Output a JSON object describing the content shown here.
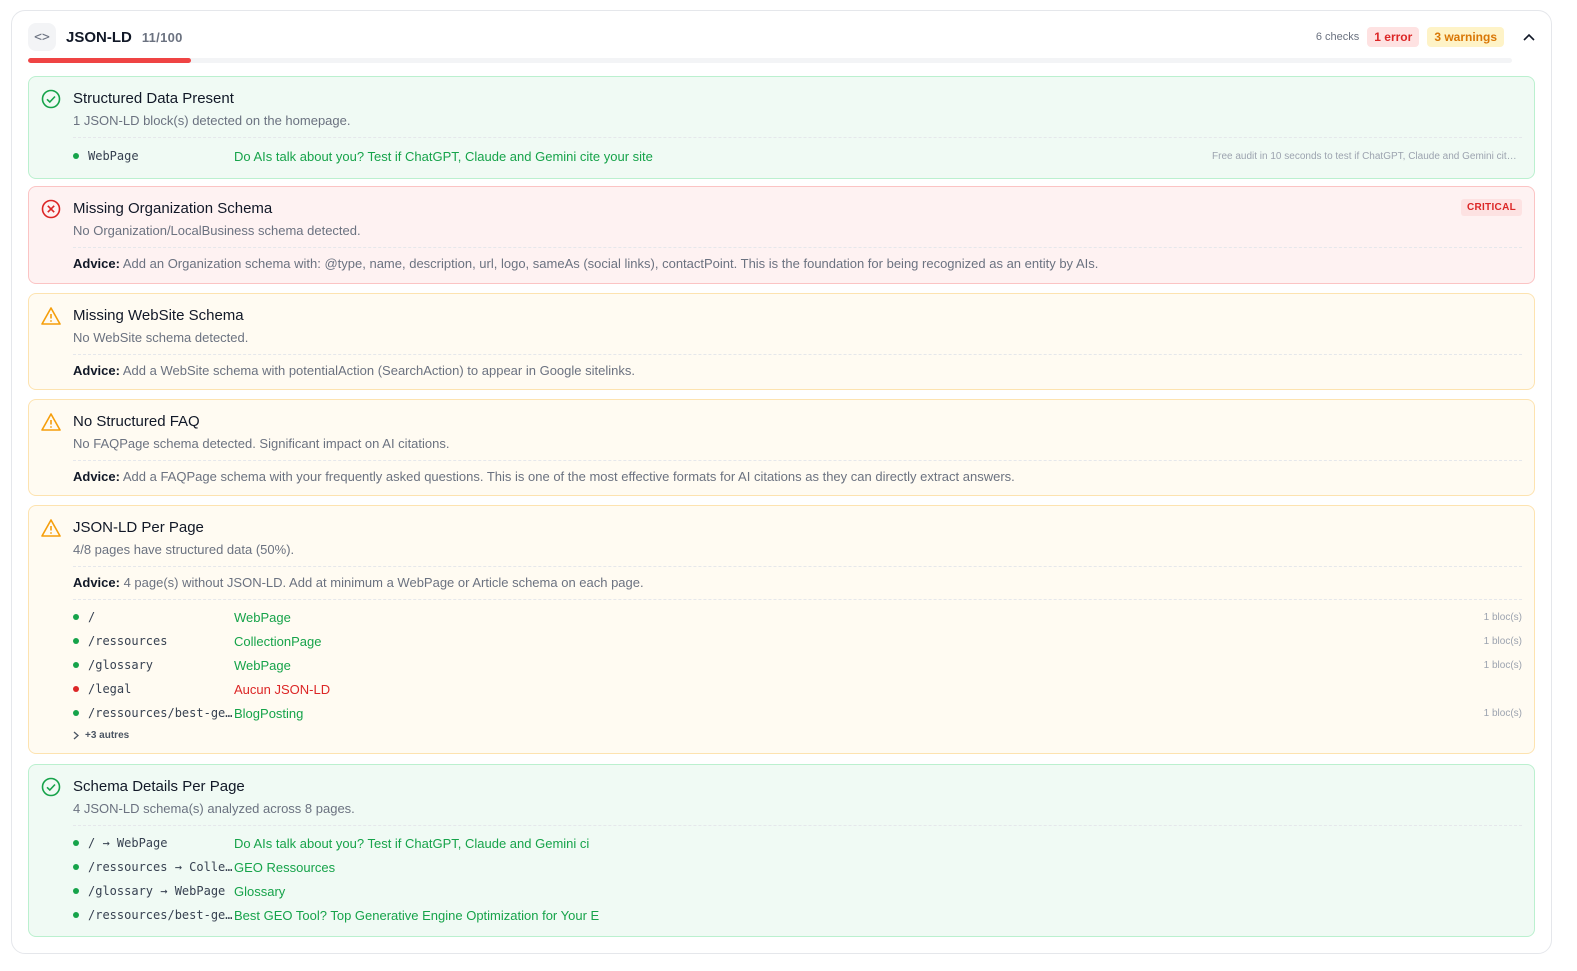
{
  "header": {
    "title": "JSON-LD",
    "score": "11/100",
    "score_value": 11,
    "checks": "6 checks",
    "errors": "1 error",
    "warnings": "3 warnings"
  },
  "colors": {
    "ok": "#16a34a",
    "error": "#dc2626",
    "warning": "#f59e0b",
    "progress": "#ef4444"
  },
  "cards": {
    "structured": {
      "title": "Structured Data Present",
      "desc": "1 JSON-LD block(s) detected on the homepage.",
      "row": {
        "key": "WebPage",
        "value": "Do AIs talk about you? Test if ChatGPT, Claude and Gemini cite your site",
        "meta": "Free audit in 10 seconds to test if ChatGPT, Claude and Gemini cite your site"
      }
    },
    "org": {
      "title": "Missing Organization Schema",
      "desc": "No Organization/LocalBusiness schema detected.",
      "badge": "CRITICAL",
      "advice_label": "Advice:",
      "advice": "Add an Organization schema with: @type, name, description, url, logo, sameAs (social links), contactPoint. This is the foundation for being recognized as an entity by AIs."
    },
    "website": {
      "title": "Missing WebSite Schema",
      "desc": "No WebSite schema detected.",
      "advice_label": "Advice:",
      "advice": "Add a WebSite schema with potentialAction (SearchAction) to appear in Google sitelinks."
    },
    "faq": {
      "title": "No Structured FAQ",
      "desc": "No FAQPage schema detected. Significant impact on AI citations.",
      "advice_label": "Advice:",
      "advice": "Add a FAQPage schema with your frequently asked questions. This is one of the most effective formats for AI citations as they can directly extract answers."
    },
    "perpage": {
      "title": "JSON-LD Per Page",
      "desc": "4/8 pages have structured data (50%).",
      "advice_label": "Advice:",
      "advice": "4 page(s) without JSON-LD. Add at minimum a WebPage or Article schema on each page.",
      "rows": [
        {
          "key": "/",
          "value": "WebPage",
          "meta": "1 bloc(s)"
        },
        {
          "key": "/ressources",
          "value": "CollectionPage",
          "meta": "1 bloc(s)"
        },
        {
          "key": "/glossary",
          "value": "WebPage",
          "meta": "1 bloc(s)"
        },
        {
          "key": "/legal",
          "value": "Aucun JSON-LD",
          "meta": ""
        },
        {
          "key": "/ressources/best-geo-tool",
          "value": "BlogPosting",
          "meta": "1 bloc(s)"
        }
      ],
      "more": "+3 autres"
    },
    "details": {
      "title": "Schema Details Per Page",
      "desc": "4 JSON-LD schema(s) analyzed across 8 pages.",
      "rows": [
        {
          "key": "/ → WebPage",
          "value": "Do AIs talk about you? Test if ChatGPT, Claude and Gemini ci"
        },
        {
          "key": "/ressources → CollectionPage",
          "value": "GEO Ressources"
        },
        {
          "key": "/glossary → WebPage",
          "value": "Glossary"
        },
        {
          "key": "/ressources/best-geo-tool → BlogPosting",
          "value": "Best GEO Tool? Top Generative Engine Optimization for Your E"
        }
      ]
    }
  }
}
